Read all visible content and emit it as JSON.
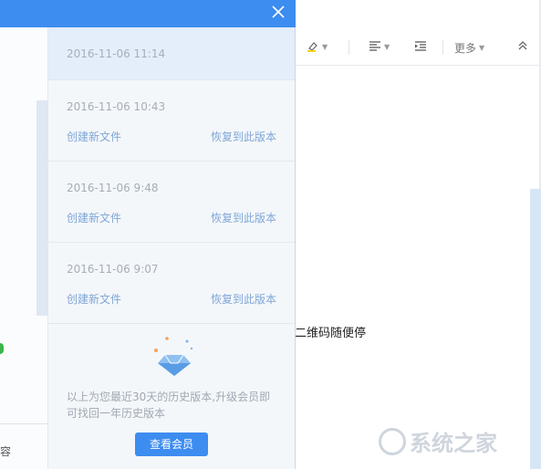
{
  "panel": {
    "versions": [
      {
        "time": "2016-11-06 11:14"
      },
      {
        "time": "2016-11-06 10:43",
        "action": "创建新文件",
        "restore": "恢复到此版本"
      },
      {
        "time": "2016-11-06 9:48",
        "action": "创建新文件",
        "restore": "恢复到此版本"
      },
      {
        "time": "2016-11-06 9:07",
        "action": "创建新文件",
        "restore": "恢复到此版本"
      }
    ],
    "note": "以上为您最近30天的历史版本,升级会员即可找回一年历史版本",
    "member_button": "查看会员",
    "accent_color": "#3d8cf0"
  },
  "toolbar": {
    "more_label": "更多"
  },
  "editor": {
    "visible_text": "二维码随便停"
  },
  "watermark": {
    "text": "系统之家"
  },
  "left": {
    "glyph": "容"
  }
}
